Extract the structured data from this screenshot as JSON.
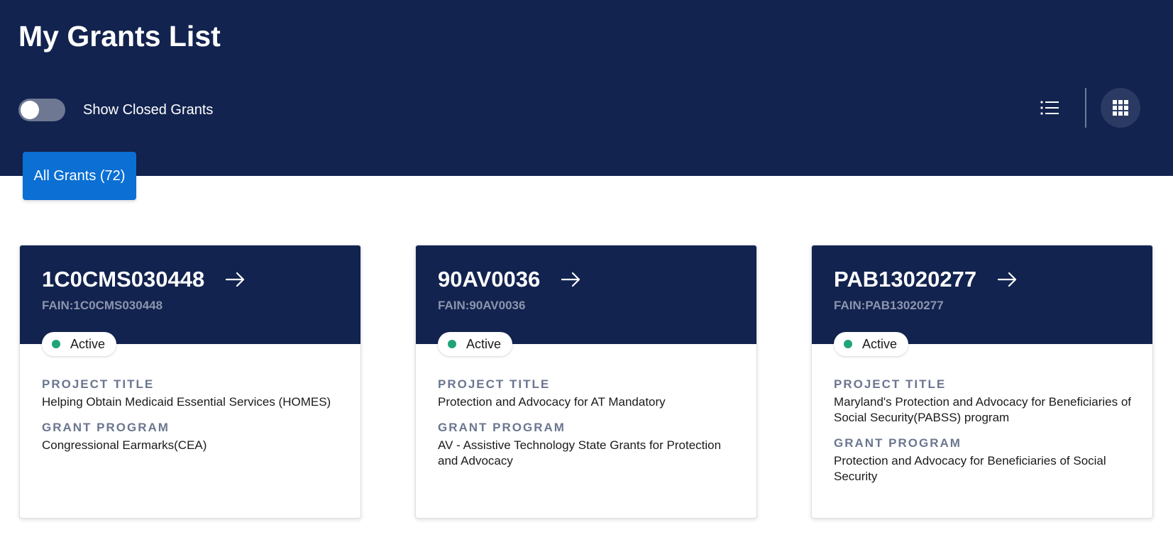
{
  "header": {
    "title": "My Grants List",
    "toggle_label": "Show Closed Grants",
    "toggle_on": false,
    "list_view_icon": "list-icon",
    "grid_view_icon": "grid-icon"
  },
  "tabs": [
    {
      "label": "All Grants (72)",
      "active": true
    }
  ],
  "labels": {
    "project_title": "PROJECT TITLE",
    "grant_program": "GRANT PROGRAM"
  },
  "grants": [
    {
      "id": "1C0CMS030448",
      "fain": "FAIN:1C0CMS030448",
      "status": "Active",
      "project_title": "Helping Obtain Medicaid Essential Services (HOMES)",
      "grant_program": "Congressional Earmarks(CEA)"
    },
    {
      "id": "90AV0036",
      "fain": "FAIN:90AV0036",
      "status": "Active",
      "project_title": "Protection and Advocacy for AT Mandatory",
      "grant_program": "AV - Assistive Technology State Grants for Protection and Advocacy"
    },
    {
      "id": "PAB13020277",
      "fain": "FAIN:PAB13020277",
      "status": "Active",
      "project_title": "Maryland's Protection and Advocacy for Beneficiaries of Social Security(PABSS) program",
      "grant_program": "Protection and Advocacy for Beneficiaries of Social Security"
    }
  ],
  "colors": {
    "header_bg": "#12234f",
    "tab_active": "#0b6fd4",
    "status_active": "#1fa37a"
  }
}
